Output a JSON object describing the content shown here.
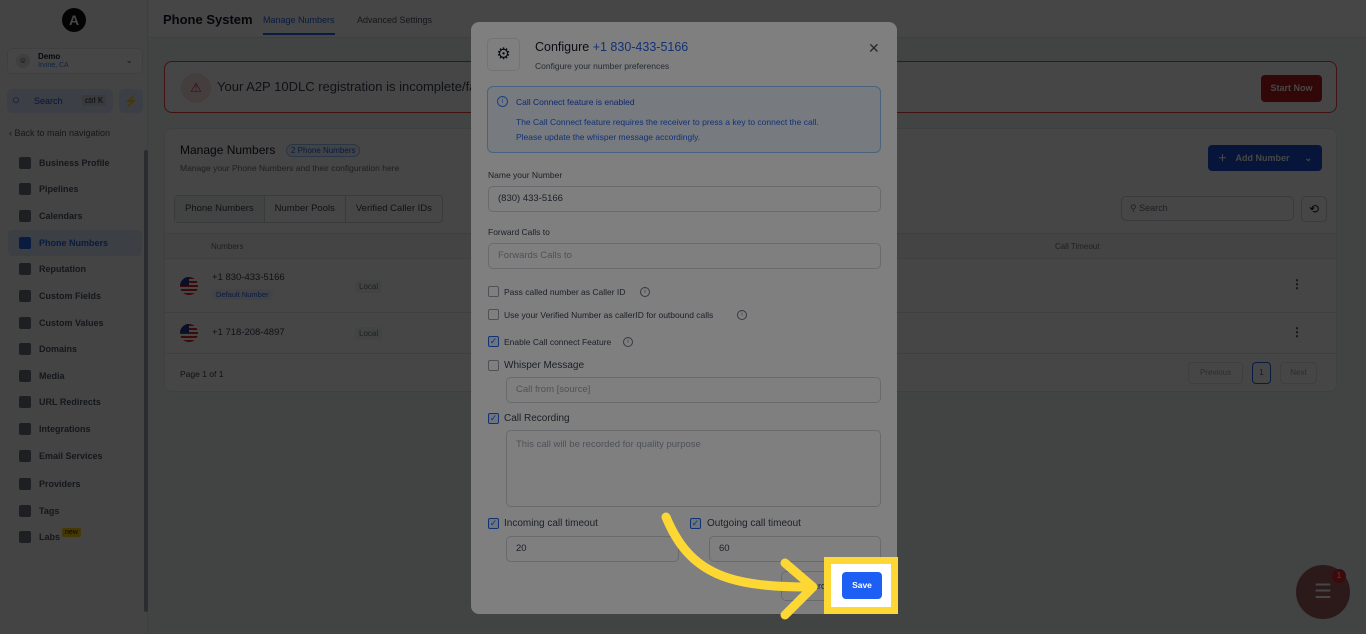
{
  "sidebar": {
    "logo": "A",
    "account": {
      "name": "Demo",
      "location": "Irvine, CA"
    },
    "search": {
      "label": "Search",
      "shortcut": "ctrl K"
    },
    "back_label": "Back to main navigation",
    "items": [
      {
        "label": "Business Profile"
      },
      {
        "label": "Pipelines"
      },
      {
        "label": "Calendars"
      },
      {
        "label": "Phone Numbers",
        "active": true
      },
      {
        "label": "Reputation"
      },
      {
        "label": "Custom Fields"
      },
      {
        "label": "Custom Values"
      },
      {
        "label": "Domains"
      },
      {
        "label": "Media"
      },
      {
        "label": "URL Redirects"
      },
      {
        "label": "Integrations"
      },
      {
        "label": "Email Services"
      },
      {
        "label": "Providers"
      },
      {
        "label": "Tags"
      },
      {
        "label": "Labs",
        "badge": "new"
      }
    ]
  },
  "header": {
    "title": "Phone System",
    "tabs": [
      {
        "label": "Manage Numbers",
        "active": true
      },
      {
        "label": "Advanced Settings"
      }
    ]
  },
  "alert": {
    "text": "Your A2P 10DLC registration is incomplete/fa",
    "button": "Start Now"
  },
  "manage": {
    "title": "Manage Numbers",
    "badge": "2 Phone Numbers",
    "subtitle": "Manage your Phone Numbers and their configuration here",
    "add_button": "Add Number",
    "tabs": [
      "Phone Numbers",
      "Number Pools",
      "Verified Caller IDs"
    ],
    "search_placeholder": "Search",
    "columns": {
      "numbers": "Numbers",
      "call_timeout": "Call Timeout"
    },
    "rows": [
      {
        "number": "+1 830-433-5166",
        "tag": "Default Number",
        "type": "Local"
      },
      {
        "number": "+1 718-208-4897",
        "type": "Local"
      }
    ],
    "page_info": "Page 1 of 1",
    "pagination": {
      "previous": "Previous",
      "current": "1",
      "next": "Next"
    }
  },
  "modal": {
    "title_prefix": "Configure",
    "title_number": "+1 830-433-5166",
    "subtitle": "Configure your number preferences",
    "info_title": "Call Connect feature is enabled",
    "info_body": "The Call Connect feature requires the receiver to press a key to connect the call. Please update the whisper message accordingly.",
    "name_label": "Name your Number",
    "name_value": "(830) 433-5166",
    "forward_label": "Forward Calls to",
    "forward_placeholder": "Forwards Calls to",
    "options": [
      {
        "label": "Pass called number as Caller ID",
        "checked": false
      },
      {
        "label": "Use your Verified Number as callerID for outbound calls",
        "checked": false
      },
      {
        "label": "Enable Call connect Feature",
        "checked": true
      }
    ],
    "whisper": {
      "label": "Whisper Message",
      "checked": false,
      "placeholder": "Call from [source]"
    },
    "recording": {
      "label": "Call Recording",
      "checked": true,
      "placeholder": "This call will be recorded for quality purpose"
    },
    "incoming": {
      "label": "Incoming call timeout",
      "checked": true,
      "value": "20"
    },
    "outgoing": {
      "label": "Outgoing call timeout",
      "checked": true,
      "value": "60"
    },
    "discard_label": "ard",
    "save_label": "Save"
  },
  "chat": {
    "count": "1"
  },
  "colors": {
    "accent": "#1d5ef5",
    "highlight": "#fdd835",
    "danger": "#b91c1c"
  }
}
